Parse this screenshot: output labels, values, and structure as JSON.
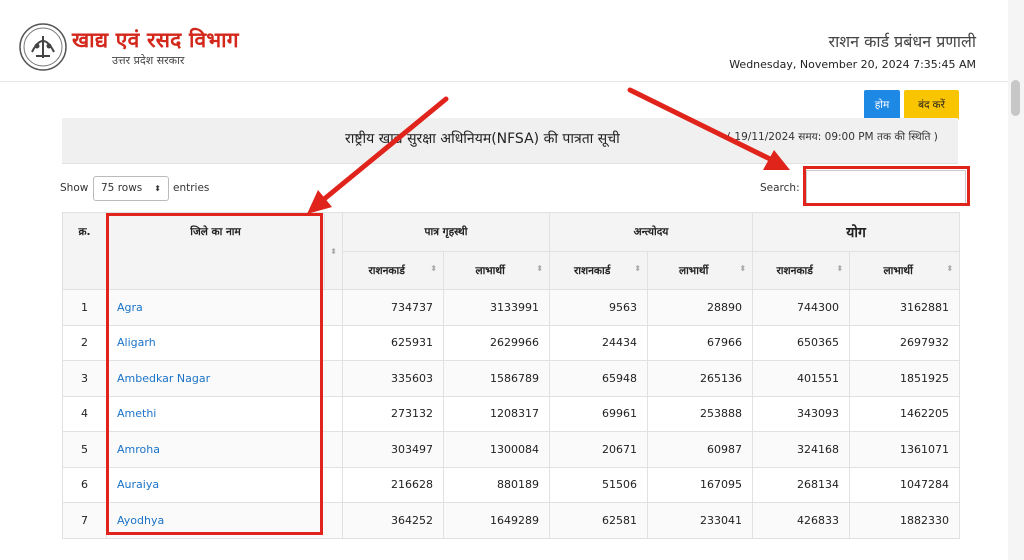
{
  "header": {
    "dept_title": "खाद्य एवं रसद विभाग",
    "dept_subtitle": "उत्तर प्रदेश सरकार",
    "system_title": "राशन कार्ड प्रबंधन प्रणाली",
    "datetime": "Wednesday, November 20, 2024 7:35:45 AM",
    "logo_icon": "up-government-emblem-icon"
  },
  "actions": {
    "home_label": "होम",
    "close_label": "बंद करें",
    "home_color": "#1e88e5",
    "close_color": "#f9c400"
  },
  "page": {
    "title": "राष्ट्रीय खाद्य सुरक्षा अधिनियम(NFSA) की पात्रता सूची",
    "status_note": "( 19/11/2024 समय: 09:00 PM तक की स्थिति )"
  },
  "controls": {
    "show_label": "Show",
    "rows_value": "75 rows",
    "entries_label": "entries",
    "search_label": "Search:",
    "search_value": ""
  },
  "table": {
    "headers": {
      "sr": "क्र.",
      "district": "जिले का नाम",
      "eligible_household": "पात्र गृहस्थी",
      "antyodaya": "अन्त्योदय",
      "total": "योग",
      "ration_card": "राशनकार्ड",
      "beneficiary": "लाभार्थी"
    },
    "rows": [
      {
        "sr": "1",
        "district": "Agra",
        "ph_rc": "734737",
        "ph_ben": "3133991",
        "aay_rc": "9563",
        "aay_ben": "28890",
        "tot_rc": "744300",
        "tot_ben": "3162881"
      },
      {
        "sr": "2",
        "district": "Aligarh",
        "ph_rc": "625931",
        "ph_ben": "2629966",
        "aay_rc": "24434",
        "aay_ben": "67966",
        "tot_rc": "650365",
        "tot_ben": "2697932"
      },
      {
        "sr": "3",
        "district": "Ambedkar Nagar",
        "ph_rc": "335603",
        "ph_ben": "1586789",
        "aay_rc": "65948",
        "aay_ben": "265136",
        "tot_rc": "401551",
        "tot_ben": "1851925"
      },
      {
        "sr": "4",
        "district": "Amethi",
        "ph_rc": "273132",
        "ph_ben": "1208317",
        "aay_rc": "69961",
        "aay_ben": "253888",
        "tot_rc": "343093",
        "tot_ben": "1462205"
      },
      {
        "sr": "5",
        "district": "Amroha",
        "ph_rc": "303497",
        "ph_ben": "1300084",
        "aay_rc": "20671",
        "aay_ben": "60987",
        "tot_rc": "324168",
        "tot_ben": "1361071"
      },
      {
        "sr": "6",
        "district": "Auraiya",
        "ph_rc": "216628",
        "ph_ben": "880189",
        "aay_rc": "51506",
        "aay_ben": "167095",
        "tot_rc": "268134",
        "tot_ben": "1047284"
      },
      {
        "sr": "7",
        "district": "Ayodhya",
        "ph_rc": "364252",
        "ph_ben": "1649289",
        "aay_rc": "62581",
        "aay_ben": "233041",
        "tot_rc": "426833",
        "tot_ben": "1882330"
      }
    ]
  },
  "colors": {
    "brand_red": "#d4271b",
    "link_blue": "#1a73c8",
    "annotation_red": "#e0241b"
  }
}
